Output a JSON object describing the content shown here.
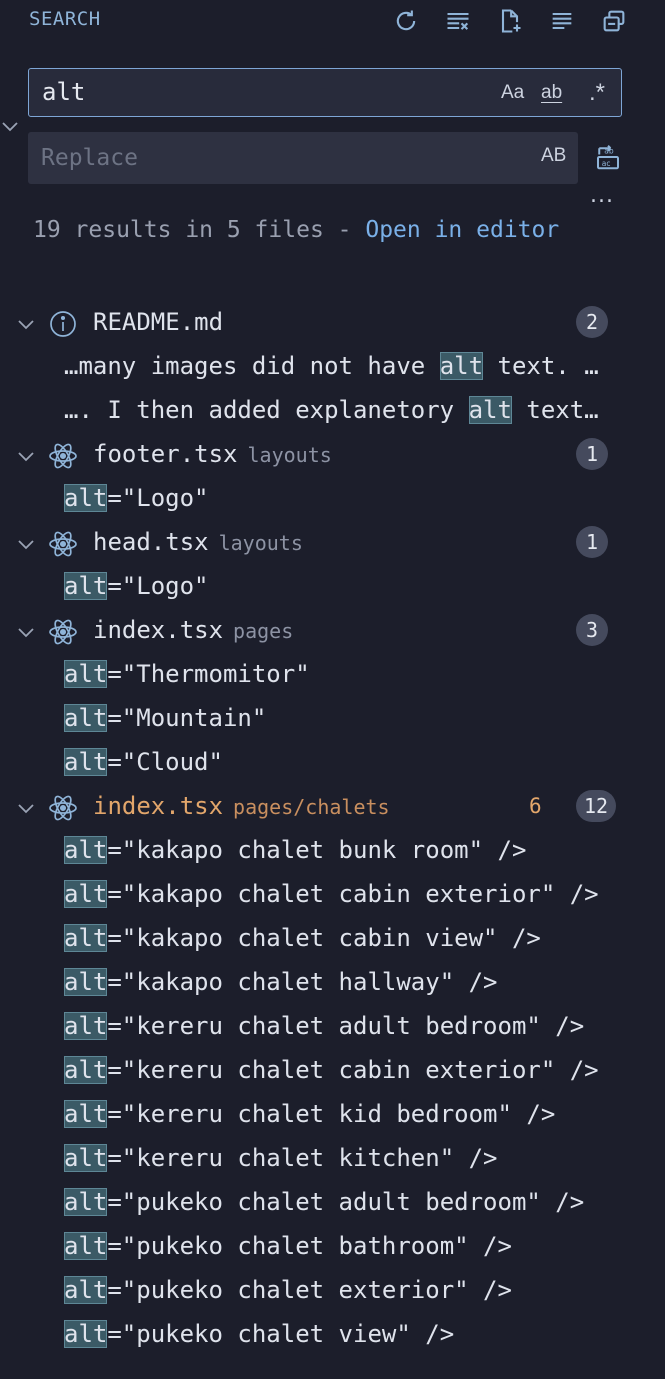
{
  "header": {
    "title": "SEARCH",
    "actions": [
      "refresh-icon",
      "clear-results-icon",
      "new-search-editor-icon",
      "view-as-tree-icon",
      "collapse-all-icon"
    ]
  },
  "search": {
    "value": "alt",
    "match_case_label": "Aa",
    "whole_word_label": "ab",
    "regex_label": ".*"
  },
  "replace": {
    "placeholder": "Replace",
    "value": "",
    "preserve_case_label": "AB"
  },
  "more_label": "...",
  "summary": {
    "text": "19 results in 5 files - ",
    "link": "Open in editor"
  },
  "colors": {
    "accent": "#7ab0e8",
    "highlight": "#3b5a66",
    "modified": "#e2a66b",
    "background": "#1c1e2b"
  },
  "results": [
    {
      "file": "README.md",
      "dir": "",
      "icon": "info-icon",
      "modified": false,
      "mod_count": "",
      "count": "2",
      "matches": [
        {
          "pre": "…many images did not have ",
          "hit": "alt",
          "post": " text. …"
        },
        {
          "pre": "…. I then added explanetory ",
          "hit": "alt",
          "post": " text…"
        }
      ]
    },
    {
      "file": "footer.tsx",
      "dir": "layouts",
      "icon": "react-icon",
      "modified": false,
      "mod_count": "",
      "count": "1",
      "matches": [
        {
          "pre": "",
          "hit": "alt",
          "post": "=\"Logo\""
        }
      ]
    },
    {
      "file": "head.tsx",
      "dir": "layouts",
      "icon": "react-icon",
      "modified": false,
      "mod_count": "",
      "count": "1",
      "matches": [
        {
          "pre": "",
          "hit": "alt",
          "post": "=\"Logo\""
        }
      ]
    },
    {
      "file": "index.tsx",
      "dir": "pages",
      "icon": "react-icon",
      "modified": false,
      "mod_count": "",
      "count": "3",
      "matches": [
        {
          "pre": "",
          "hit": "alt",
          "post": "=\"Thermomitor\""
        },
        {
          "pre": "",
          "hit": "alt",
          "post": "=\"Mountain\""
        },
        {
          "pre": "",
          "hit": "alt",
          "post": "=\"Cloud\""
        }
      ]
    },
    {
      "file": "index.tsx",
      "dir": "pages/chalets",
      "icon": "react-icon",
      "modified": true,
      "mod_count": "6",
      "count": "12",
      "matches": [
        {
          "pre": "",
          "hit": "alt",
          "post": "=\"kakapo chalet bunk room\" />"
        },
        {
          "pre": "",
          "hit": "alt",
          "post": "=\"kakapo chalet cabin exterior\" />"
        },
        {
          "pre": "",
          "hit": "alt",
          "post": "=\"kakapo chalet cabin view\" />"
        },
        {
          "pre": "",
          "hit": "alt",
          "post": "=\"kakapo chalet hallway\" />"
        },
        {
          "pre": "",
          "hit": "alt",
          "post": "=\"kereru chalet adult bedroom\" />"
        },
        {
          "pre": "",
          "hit": "alt",
          "post": "=\"kereru chalet cabin exterior\" />"
        },
        {
          "pre": "",
          "hit": "alt",
          "post": "=\"kereru chalet kid bedroom\" />"
        },
        {
          "pre": "",
          "hit": "alt",
          "post": "=\"kereru chalet kitchen\" />"
        },
        {
          "pre": "",
          "hit": "alt",
          "post": "=\"pukeko chalet adult bedroom\" />"
        },
        {
          "pre": "",
          "hit": "alt",
          "post": "=\"pukeko chalet bathroom\" />"
        },
        {
          "pre": "",
          "hit": "alt",
          "post": "=\"pukeko chalet exterior\" />"
        },
        {
          "pre": "",
          "hit": "alt",
          "post": "=\"pukeko chalet view\" />"
        }
      ]
    }
  ]
}
